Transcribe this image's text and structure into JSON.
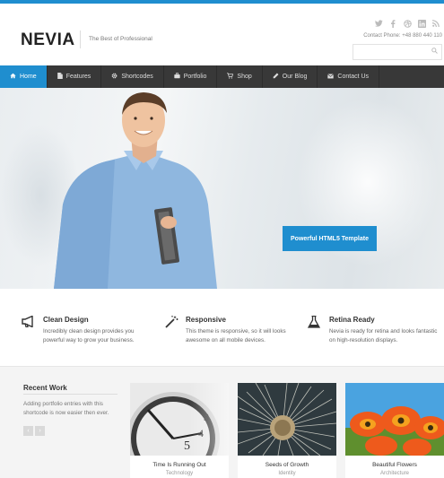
{
  "header": {
    "logo": "NEVIA",
    "tagline": "The Best of Professional",
    "contact": "Contact Phone: +48 880 440 110",
    "search_placeholder": "",
    "social": [
      "twitter-icon",
      "facebook-icon",
      "dribbble-icon",
      "linkedin-icon",
      "rss-icon"
    ]
  },
  "nav": {
    "items": [
      {
        "label": "Home",
        "icon": "home-icon"
      },
      {
        "label": "Features",
        "icon": "page-icon"
      },
      {
        "label": "Shortcodes",
        "icon": "gear-icon"
      },
      {
        "label": "Portfolio",
        "icon": "briefcase-icon"
      },
      {
        "label": "Shop",
        "icon": "cart-icon"
      },
      {
        "label": "Our Blog",
        "icon": "pencil-icon"
      },
      {
        "label": "Contact Us",
        "icon": "envelope-icon"
      }
    ]
  },
  "hero": {
    "button_label": "Powerful HTML5 Template"
  },
  "features": [
    {
      "title": "Clean Design",
      "text": "Incredibly clean design provides you powerful way to grow your business.",
      "icon": "megaphone-icon"
    },
    {
      "title": "Responsive",
      "text": "This theme is responsive, so it will looks awesome on all mobile devices.",
      "icon": "magic-wand-icon"
    },
    {
      "title": "Retina Ready",
      "text": "Nevia is ready for retina and looks fantastic on high-resolution displays.",
      "icon": "flask-icon"
    }
  ],
  "recent_work": {
    "title": "Recent Work",
    "text": "Adding portfolio entries with this shortcode is now easier then ever.",
    "items": [
      {
        "title": "Time Is Running Out",
        "category": "Technology"
      },
      {
        "title": "Seeds of Growth",
        "category": "Identity"
      },
      {
        "title": "Beautiful Flowers",
        "category": "Architecture"
      }
    ]
  },
  "colors": {
    "accent": "#1f8ecf",
    "nav_bg": "#383838"
  }
}
